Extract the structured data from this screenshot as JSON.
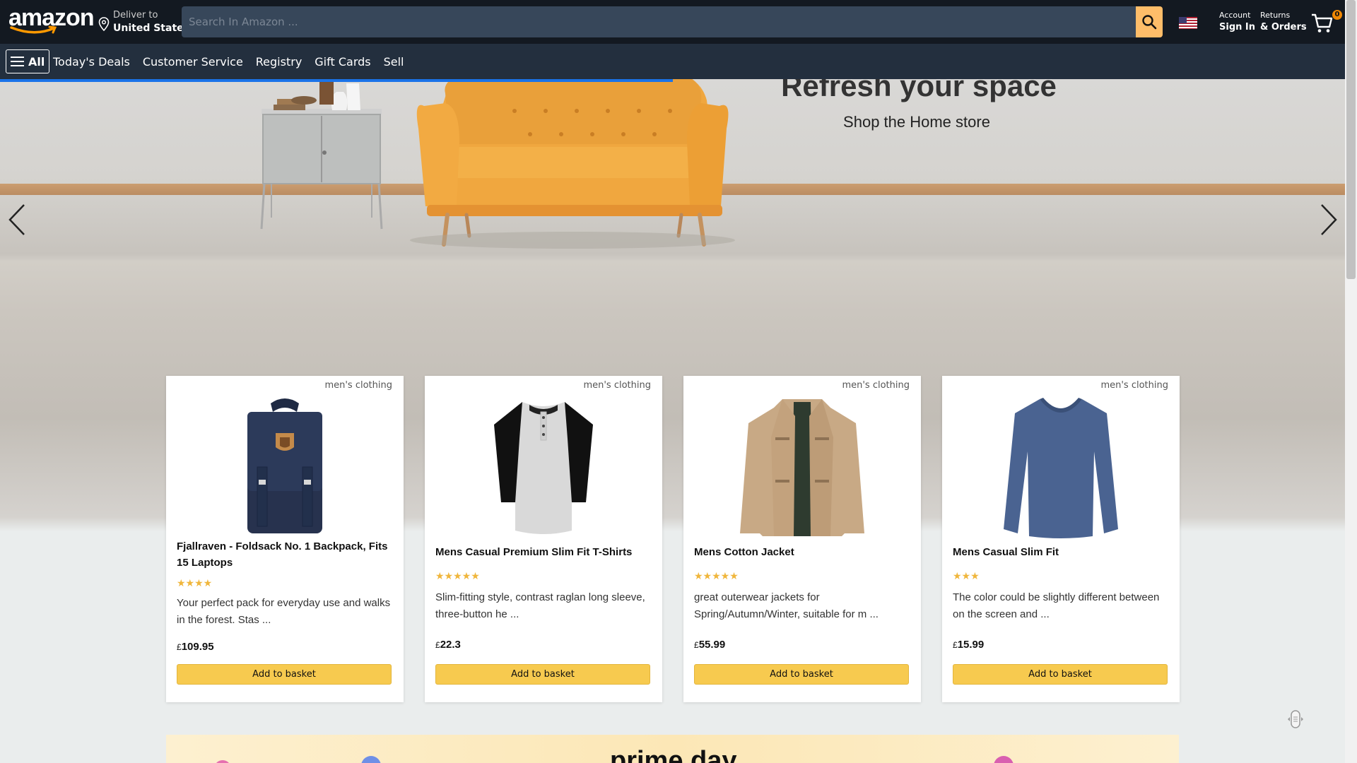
{
  "header": {
    "logo": "amazon",
    "deliver_line1": "Deliver to",
    "deliver_line2": "United States",
    "search_placeholder": "Search In Amazon ...",
    "account_line1": "Account",
    "account_line2": "Sign In",
    "returns_line1": "Returns",
    "returns_line2": "& Orders",
    "cart_count": "0",
    "icons": [
      "location-pin-icon",
      "search-icon",
      "us-flag-icon",
      "cart-icon"
    ]
  },
  "subnav": {
    "all_label": "All",
    "links": [
      "Today's Deals",
      "Customer Service",
      "Registry",
      "Gift Cards",
      "Sell"
    ]
  },
  "hero": {
    "title": "Refresh your space",
    "subtitle": "Shop the Home store"
  },
  "products": [
    {
      "category": "men's clothing",
      "title": "Fjallraven - Foldsack No. 1 Backpack, Fits 15 Laptops",
      "rating": 4,
      "stars": "★★★★",
      "description": "Your perfect pack for everyday use and walks in the forest. Stas ...",
      "currency": "£",
      "price": "109.95",
      "button": "Add to basket"
    },
    {
      "category": "men's clothing",
      "title": "Mens Casual Premium Slim Fit T-Shirts",
      "rating": 5,
      "stars": "★★★★★",
      "description": "Slim-fitting style, contrast raglan long sleeve, three-button he ...",
      "currency": "£",
      "price": "22.3",
      "button": "Add to basket"
    },
    {
      "category": "men's clothing",
      "title": "Mens Cotton Jacket",
      "rating": 5,
      "stars": "★★★★★",
      "description": "great outerwear jackets for Spring/Autumn/Winter, suitable for m ...",
      "currency": "£",
      "price": "55.99",
      "button": "Add to basket"
    },
    {
      "category": "men's clothing",
      "title": "Mens Casual Slim Fit",
      "rating": 3,
      "stars": "★★★",
      "description": "The color could be slightly different between on the screen and ...",
      "currency": "£",
      "price": "15.99",
      "button": "Add to basket"
    }
  ],
  "promo": {
    "text": "prime day"
  },
  "colors": {
    "nav_top": "#131921",
    "nav_bottom": "#232f3e",
    "search_button": "#febd69",
    "add_button": "#f7ca4f",
    "stars": "#f0b63c"
  }
}
